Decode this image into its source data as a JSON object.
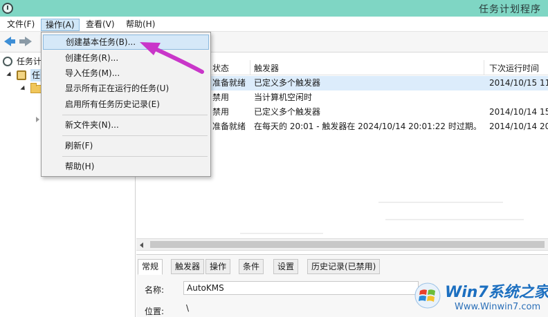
{
  "window": {
    "title": "任务计划程序"
  },
  "menubar": {
    "items": [
      {
        "label": "文件(F)"
      },
      {
        "label": "操作(A)"
      },
      {
        "label": "查看(V)"
      },
      {
        "label": "帮助(H)"
      }
    ],
    "active_index": 1
  },
  "tree": {
    "items": [
      {
        "label": "任务计"
      },
      {
        "label": "任"
      }
    ]
  },
  "dropdown": {
    "items": [
      {
        "label": "创建基本任务(B)..."
      },
      {
        "label": "创建任务(R)..."
      },
      {
        "label": "导入任务(M)..."
      },
      {
        "label": "显示所有正在运行的任务(U)"
      },
      {
        "label": "启用所有任务历史记录(E)"
      },
      {
        "label": "新文件夹(N)..."
      },
      {
        "label": "刷新(F)"
      },
      {
        "label": "帮助(H)"
      }
    ],
    "highlighted_index": 0
  },
  "task_list": {
    "columns": {
      "status": "状态",
      "trigger": "触发器",
      "next_run": "下次运行时间"
    },
    "rows": [
      {
        "status": "准备就绪",
        "trigger": "已定义多个触发器",
        "next_run": "2014/10/15 11"
      },
      {
        "status": "禁用",
        "trigger": "当计算机空闲时",
        "next_run": ""
      },
      {
        "status": "禁用",
        "trigger": "已定义多个触发器",
        "next_run": "2014/10/14 15"
      },
      {
        "status": "准备就绪",
        "trigger": "在每天的 20:01 - 触发器在 2024/10/14 20:01:22 时过期。",
        "next_run": "2014/10/14 20"
      }
    ]
  },
  "detail": {
    "tabs": [
      {
        "label": "常规"
      },
      {
        "label": "触发器"
      },
      {
        "label": "操作"
      },
      {
        "label": "条件"
      },
      {
        "label": "设置"
      },
      {
        "label": "历史记录(已禁用)"
      }
    ],
    "active_tab": 0,
    "name_label": "名称:",
    "name_value": "AutoKMS",
    "location_label": "位置:",
    "location_value": "\\"
  },
  "watermark": {
    "brand": "Win7系统之家",
    "url": "Www.Winwin7.com"
  },
  "colors": {
    "titlebar": "#7fd6c4",
    "menu_highlight": "#d5e8f8",
    "annotation_arrow": "#c936c9"
  }
}
